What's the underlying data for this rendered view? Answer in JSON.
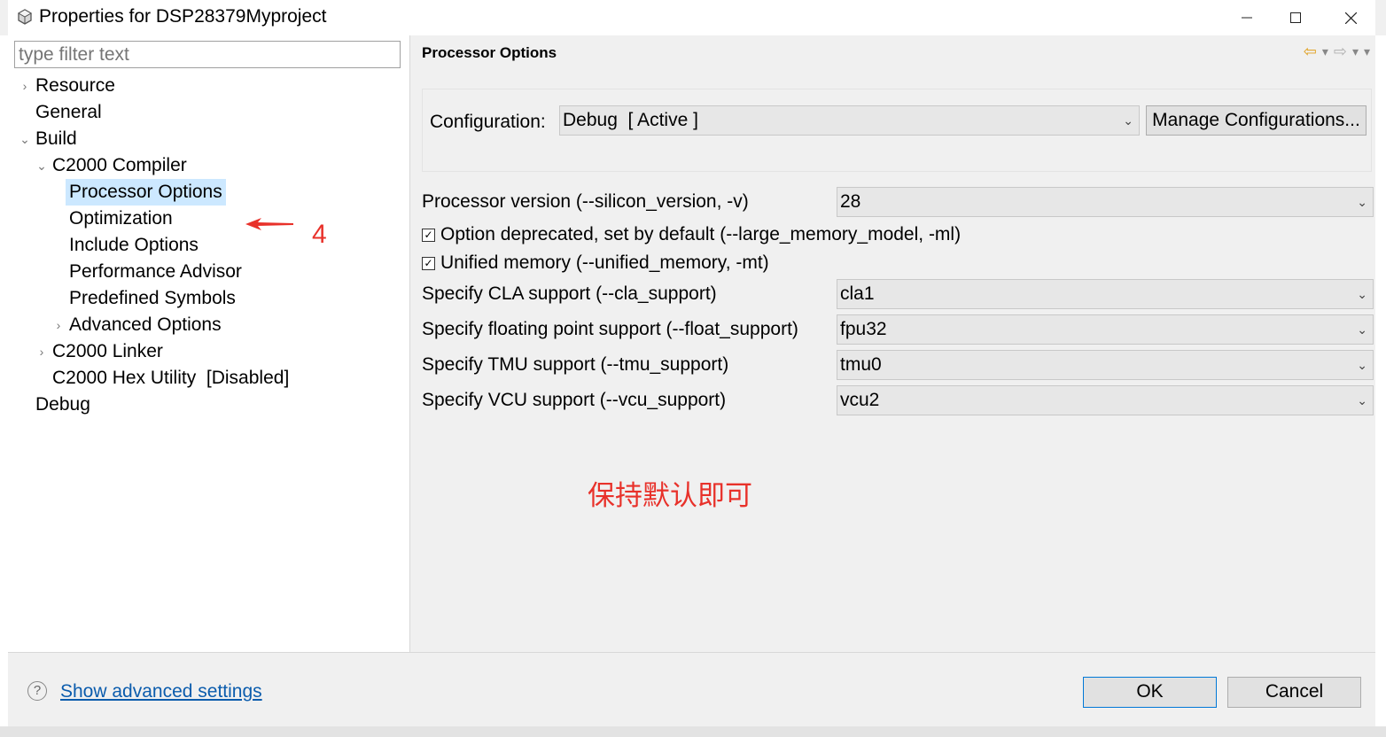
{
  "window": {
    "title": "Properties for DSP28379Myproject",
    "minimize": "—",
    "maximize": "☐",
    "close": "✕"
  },
  "filter": {
    "placeholder": "type filter text"
  },
  "tree": {
    "resource": "Resource",
    "general": "General",
    "build": "Build",
    "c2000_compiler": "C2000 Compiler",
    "processor_options": "Processor Options",
    "optimization": "Optimization",
    "include_options": "Include Options",
    "performance_advisor": "Performance Advisor",
    "predefined_symbols": "Predefined Symbols",
    "advanced_options": "Advanced Options",
    "c2000_linker": "C2000 Linker",
    "c2000_hex_utility": "C2000 Hex Utility  [Disabled]",
    "debug": "Debug"
  },
  "annotation": {
    "number": "4",
    "note": "保持默认即可",
    "color": "#e8312a"
  },
  "page": {
    "title": "Processor Options",
    "configuration_label": "Configuration:",
    "configuration_value": "Debug  [ Active ]",
    "manage_button": "Manage Configurations...",
    "processor_version_label": "Processor version (--silicon_version, -v)",
    "processor_version_value": "28",
    "large_memory_label": "Option deprecated, set by default (--large_memory_model, -ml)",
    "large_memory_checked": true,
    "unified_memory_label": "Unified memory (--unified_memory, -mt)",
    "unified_memory_checked": true,
    "cla_label": "Specify CLA support (--cla_support)",
    "cla_value": "cla1",
    "float_label": "Specify floating point support (--float_support)",
    "float_value": "fpu32",
    "tmu_label": "Specify TMU support (--tmu_support)",
    "tmu_value": "tmu0",
    "vcu_label": "Specify VCU support (--vcu_support)",
    "vcu_value": "vcu2"
  },
  "footer": {
    "advanced_link": "Show advanced settings",
    "ok": "OK",
    "cancel": "Cancel"
  }
}
